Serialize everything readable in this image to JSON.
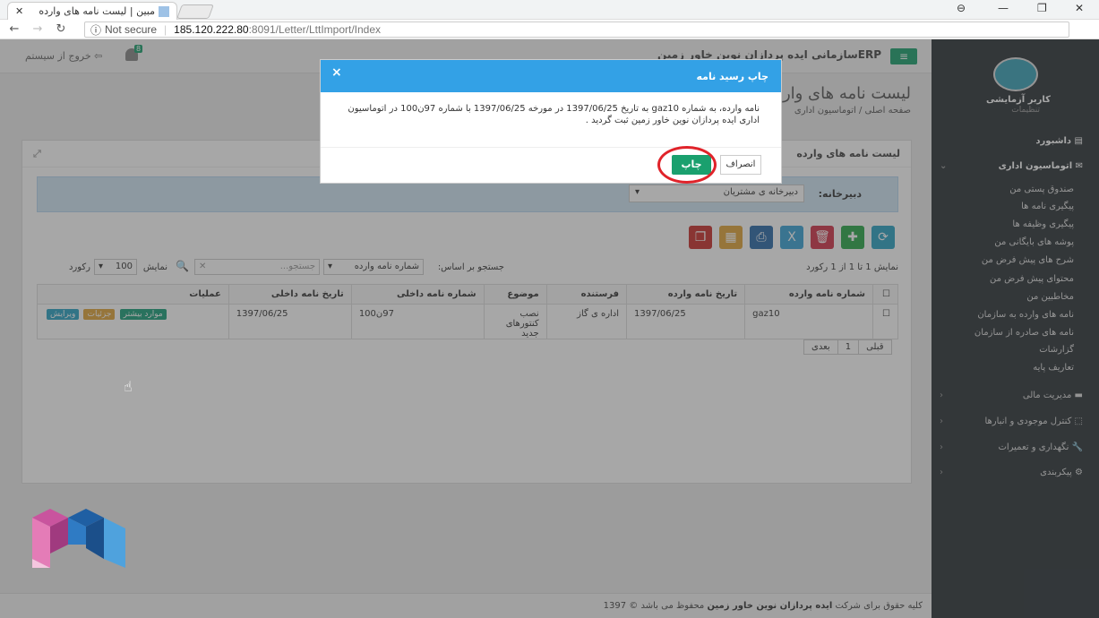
{
  "browser": {
    "tab_title": "مبین | لیست نامه های وارده",
    "tab_close": "✕",
    "security": "Not secure",
    "url_host": "185.120.222.80",
    "url_path": ":8091/Letter/LttImport/Index",
    "right_icons": "🔍 ☆ ⋮",
    "win_user": "⊖",
    "win_min": "—",
    "win_max": "❐",
    "win_close": "✕"
  },
  "topbar": {
    "org_title": "ERPسازمانی ایده پردازان نوین خاور زمین",
    "logout": "خروج از سیستم",
    "bell_count": "8",
    "menu_icon": "≡"
  },
  "page": {
    "heading": "لیست نامه های وارده",
    "breadcrumb": "صفحه اصلی  /  اتوماسیون اداری"
  },
  "panel": {
    "title": "لیست نامه های وارده",
    "filter_label": "دبیرخانه:",
    "filter_value": "دبیرخانه ی مشتریان",
    "records_info": "نمایش 1 تا 1 از 1 رکورد",
    "search_by_label": "جستجو بر اساس:",
    "search_by_value": "شماره نامه وارده",
    "search_placeholder": "جستجو...",
    "show_label": "نمایش",
    "show_value": "100",
    "records_label": "رکورد",
    "columns": [
      "شماره نامه وارده",
      "تاریخ نامه وارده",
      "فرستنده",
      "موضوع",
      "شماره نامه داخلی",
      "تاریخ نامه داخلی",
      "عملیات"
    ],
    "row": {
      "number": "gaz10",
      "date": "1397/06/25",
      "sender": "اداره ی گاز",
      "subject": "نصب کنتورهای جدید",
      "internal_number": "97ن100",
      "internal_date": "1397/06/25"
    },
    "ops": {
      "edit": "ویرایش",
      "details": "جزئیات",
      "more": "موارد بیشتر"
    },
    "pager": {
      "prev": "قبلی",
      "page": "1",
      "next": "بعدی"
    }
  },
  "sidebar": {
    "user_name": "کاربر آزمایشی",
    "user_settings": "تنظیمات",
    "dashboard": "داشبورد",
    "automation": "اتوماسیون اداری",
    "sub_items": [
      "صندوق پستی من",
      "پیگیری نامه ها",
      "پیگیری وظیفه ها",
      "پوشه های بایگانی من",
      "شرح های پیش فرض من",
      "محتوای پیش فرض من",
      "مخاطبین من",
      "نامه های وارده به سازمان",
      "نامه های صادره از سازمان",
      "گزارشات",
      "تعاریف پایه"
    ],
    "financial": "مدیریت مالی",
    "inventory": "کنترل موجودی و انبارها",
    "maintenance": "نگهداری و تعمیرات",
    "config": "پیکربندی"
  },
  "footer": {
    "prefix": "کلیه حقوق برای شرکت",
    "company": "ایده پردازان نوین خاور زمین",
    "suffix": "محفوظ می باشد © 1397"
  },
  "modal": {
    "title": "چاپ رسید نامه",
    "body": "نامه وارده، به شماره gaz10 به تاریخ 1397/06/25 در مورخه 1397/06/25 با شماره 97ن100 در اتوماسیون اداری ایده پردازان نوین خاور زمین ثبت گردید .",
    "print": "چاپ",
    "cancel": "انصراف"
  }
}
